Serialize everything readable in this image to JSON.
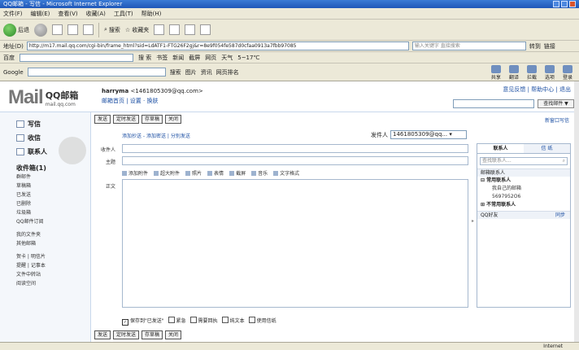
{
  "window": {
    "title": "QQ邮箱 - 写信 - Microsoft Internet Explorer"
  },
  "menu": [
    "文件(F)",
    "编辑(E)",
    "查看(V)",
    "收藏(A)",
    "工具(T)",
    "帮助(H)"
  ],
  "toolbar": {
    "back": "后退",
    "search": "搜索",
    "favorites": "收藏夹"
  },
  "address": {
    "label": "地址(D)",
    "url": "http://m17.mail.qq.com/cgi-bin/frame_html?sid=LdATF1-FTG26F2gj&r=8e9f054fe587d0cfaa0913a7fbb97085",
    "search_placeholder": "输入关键字 直接搜索",
    "go": "转到",
    "links": "链接"
  },
  "links_bar": {
    "label": "百度",
    "search_btn": "搜 索",
    "items": [
      "书签",
      "新闻",
      "截屏",
      "网页",
      "天气"
    ],
    "weather": "5~17℃"
  },
  "google_bar": {
    "label": "Google",
    "search": "搜索",
    "images": "图片",
    "news": "资讯",
    "pagerank": "网页排名",
    "right": [
      "共享",
      "翻译",
      "拦截",
      "选项",
      "登录"
    ]
  },
  "mail_header": {
    "logo": {
      "mail": "Mail",
      "brand": "QQ邮箱",
      "domain": "mail.qq.com"
    },
    "user": "harryma",
    "email": "<1461805309@qq.com>",
    "links": "邮箱首页 | 设置 · 换肤",
    "top_links": "意见反馈 | 帮助中心 | 退出",
    "search_btn": "查找邮件 ▼"
  },
  "nav": {
    "compose": "写信",
    "inbox": "收信",
    "contacts": "联系人",
    "inbox_count": "收件箱(1)",
    "folders": [
      "群邮件",
      "草稿箱",
      "已发送",
      "已删除",
      "垃圾箱",
      "QQ邮件订阅"
    ],
    "my_folders": [
      "我的文件夹",
      "其他邮箱"
    ],
    "tools": [
      "贺卡 | 明信片",
      "提醒 | 记事本",
      "文件中转站",
      "阅读空间"
    ]
  },
  "compose": {
    "buttons": [
      "发送",
      "定时发送",
      "存草稿",
      "关闭"
    ],
    "new_window": "新窗口写信",
    "add_links": "添加抄送 - 添加密送 | 分别发送",
    "sender_label": "发件人",
    "sender_value": "1461805309@qq...",
    "to_label": "收件人",
    "subject_label": "主题",
    "body_label": "正文",
    "format": [
      "添加附件",
      "超大附件",
      "照片",
      "表情",
      "截屏",
      "音乐",
      "文字格式"
    ],
    "options": [
      {
        "label": "保存到\"已发送\"",
        "checked": true
      },
      {
        "label": "紧急",
        "checked": false
      },
      {
        "label": "需要回执",
        "checked": false
      },
      {
        "label": "纯文本",
        "checked": false
      },
      {
        "label": "使用信纸",
        "checked": false
      }
    ]
  },
  "contacts_panel": {
    "tabs": [
      "联系人",
      "信 纸"
    ],
    "search_placeholder": "查找联系人...",
    "rows": [
      {
        "text": "邮箱联系人",
        "type": "band"
      },
      {
        "text": "⊟ 常用联系人",
        "type": "bold"
      },
      {
        "text": "我自己的邮箱",
        "type": "sub"
      },
      {
        "text": "5697952O6",
        "type": "sub"
      },
      {
        "text": "⊞ 不常用联系人",
        "type": "bold"
      }
    ],
    "qq_friends": "QQ好友",
    "sync": "同步"
  },
  "status": {
    "zone": "Internet"
  }
}
